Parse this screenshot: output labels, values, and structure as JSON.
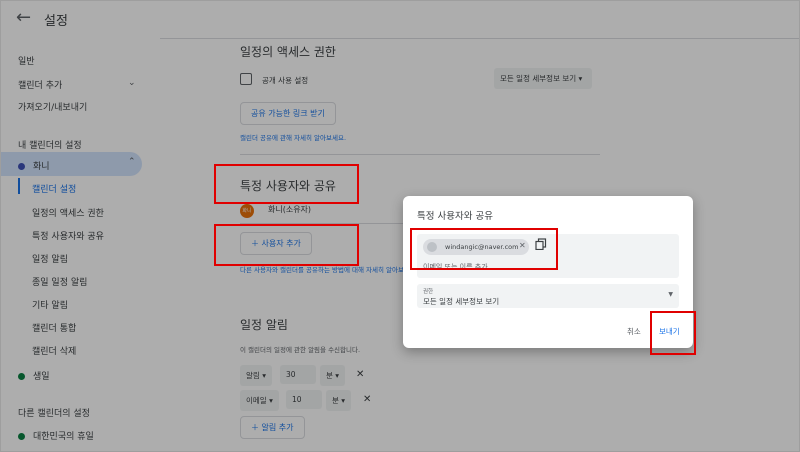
{
  "header": {
    "title": "설정"
  },
  "sidebar": {
    "items": [
      {
        "label": "일반"
      },
      {
        "label": "캘린더 추가"
      },
      {
        "label": "가져오기/내보내기"
      }
    ],
    "my_calendars_title": "내 캘린더의 설정",
    "my_calendar": {
      "name": "화니",
      "color": "#3f51b5"
    },
    "sub_items": [
      {
        "label": "캘린더 설정"
      },
      {
        "label": "일정의 액세스 권한"
      },
      {
        "label": "특정 사용자와 공유"
      },
      {
        "label": "일정 알림"
      },
      {
        "label": "종일 일정 알림"
      },
      {
        "label": "기타 알림"
      },
      {
        "label": "캘린더 통합"
      },
      {
        "label": "캘린더 삭제"
      }
    ],
    "birthday": {
      "name": "생일",
      "color": "#0b8043"
    },
    "other_calendars_title": "다른 캘린더의 설정",
    "holiday": {
      "name": "대한민국의 휴일",
      "color": "#0b8043"
    }
  },
  "access": {
    "title": "일정의 액세스 권한",
    "public_label": "공개 사용 설정",
    "public_select": "모든 일정 세부정보 보기",
    "share_link_button": "공유 가능한 링크 받기",
    "help_text": "캘린더 공유에 관해 자세히 알아보세요."
  },
  "share": {
    "title": "특정 사용자와 공유",
    "owner_avatar": "화니",
    "owner_name": "화니(소유자)",
    "add_user_button": "사용자 추가",
    "help_text": "다른 사용자와 캘린더를 공유하는 방법에 대해 자세히 알아보"
  },
  "notifications": {
    "title": "일정 알림",
    "desc": "이 캘린더의 일정에 관한 알림을 수신합니다.",
    "rows": [
      {
        "type": "알림",
        "value": "30",
        "unit": "분"
      },
      {
        "type": "이메일",
        "value": "10",
        "unit": "분"
      }
    ],
    "add_button": "알림 추가"
  },
  "dialog": {
    "title": "특정 사용자와 공유",
    "chip_email": "windangic@naver.com",
    "placeholder": "이메일 또는 이름 추가",
    "permission_label": "권한",
    "permission_value": "모든 일정 세부정보 보기",
    "cancel": "취소",
    "send": "보내기"
  },
  "icons": {
    "back": "arrow-left-icon",
    "chevron_down": "chevron-down-icon",
    "chevron_up": "chevron-up-icon",
    "plus": "plus-icon",
    "close": "close-icon",
    "copy": "copy-icon",
    "caret": "caret-down-icon"
  },
  "colors": {
    "accent": "#1a73e8",
    "highlight_box": "#e00000",
    "active_nav": "#d2e3fc"
  }
}
